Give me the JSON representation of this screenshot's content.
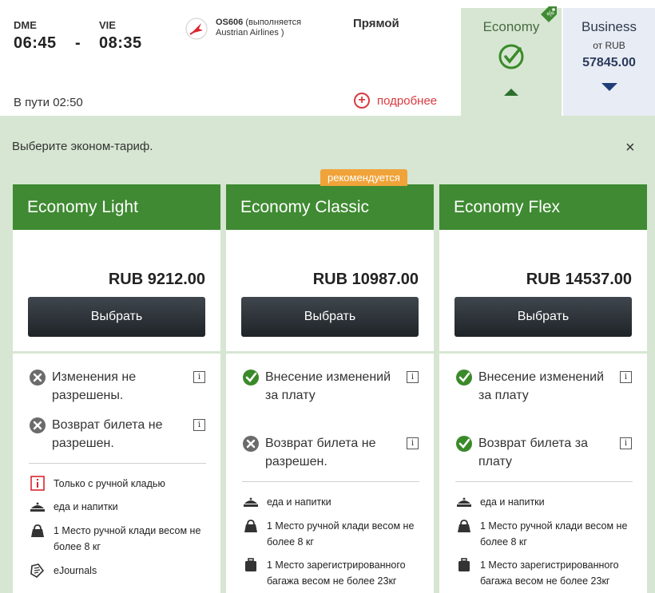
{
  "flight": {
    "from_code": "DME",
    "from_time": "06:45",
    "dash": "-",
    "to_code": "VIE",
    "to_time": "08:35",
    "flight_number": "OS606",
    "operated_by": "(выполняется",
    "airline": "Austrian Airlines )",
    "type": "Прямой",
    "duration": "В пути 02:50",
    "details_label": "подробнее"
  },
  "classes": {
    "economy": {
      "label": "Economy"
    },
    "business": {
      "label": "Business",
      "from_label": "от RUB",
      "price": "57845.00"
    }
  },
  "panel": {
    "prompt": "Выберите эконом-тариф.",
    "close": "×"
  },
  "fares": [
    {
      "name": "Economy Light",
      "price": "RUB 9212.00",
      "button": "Выбрать",
      "conditions": [
        {
          "icon": "cross-circle-icon",
          "text": "Изменения не разрешены."
        },
        {
          "icon": "cross-circle-icon",
          "text": "Возврат билета не разрешен."
        }
      ],
      "features": [
        {
          "icon": "info-box-icon",
          "text": "Только с ручной кладью"
        },
        {
          "icon": "meal-icon",
          "text": "еда и напитки"
        },
        {
          "icon": "bag-icon",
          "text": "1 Место ручной клади весом не более 8 кг"
        },
        {
          "icon": "ejournal-icon",
          "text": "eJournals"
        }
      ]
    },
    {
      "name": "Economy Classic",
      "badge": "рекомендуется",
      "price": "RUB 10987.00",
      "button": "Выбрать",
      "conditions": [
        {
          "icon": "check-circle-icon",
          "text": "Внесение изменений за плату"
        },
        {
          "icon": "cross-circle-icon",
          "text": "Возврат билета не разрешен."
        }
      ],
      "features": [
        {
          "icon": "meal-icon",
          "text": "еда и напитки"
        },
        {
          "icon": "bag-icon",
          "text": "1 Место ручной клади весом не более 8 кг"
        },
        {
          "icon": "suitcase-icon",
          "text": "1 Место зарегистрированного багажа весом не более 23кг"
        }
      ]
    },
    {
      "name": "Economy Flex",
      "price": "RUB 14537.00",
      "button": "Выбрать",
      "conditions": [
        {
          "icon": "check-circle-icon",
          "text": "Внесение изменений за плату"
        },
        {
          "icon": "check-circle-icon",
          "text": "Возврат билета за плату"
        }
      ],
      "features": [
        {
          "icon": "meal-icon",
          "text": "еда и напитки"
        },
        {
          "icon": "bag-icon",
          "text": "1 Место ручной клади весом не более 8 кг"
        },
        {
          "icon": "suitcase-icon",
          "text": "1 Место зарегистрированного багажа весом не более 23кг"
        }
      ]
    }
  ],
  "info_glyph": "i",
  "colors": {
    "header_green": "#3f8a32",
    "panel_bg": "#d6e6d2",
    "badge_orange": "#f0a339",
    "details_red": "#d93a3f",
    "business_price": "#2b3b5c"
  }
}
